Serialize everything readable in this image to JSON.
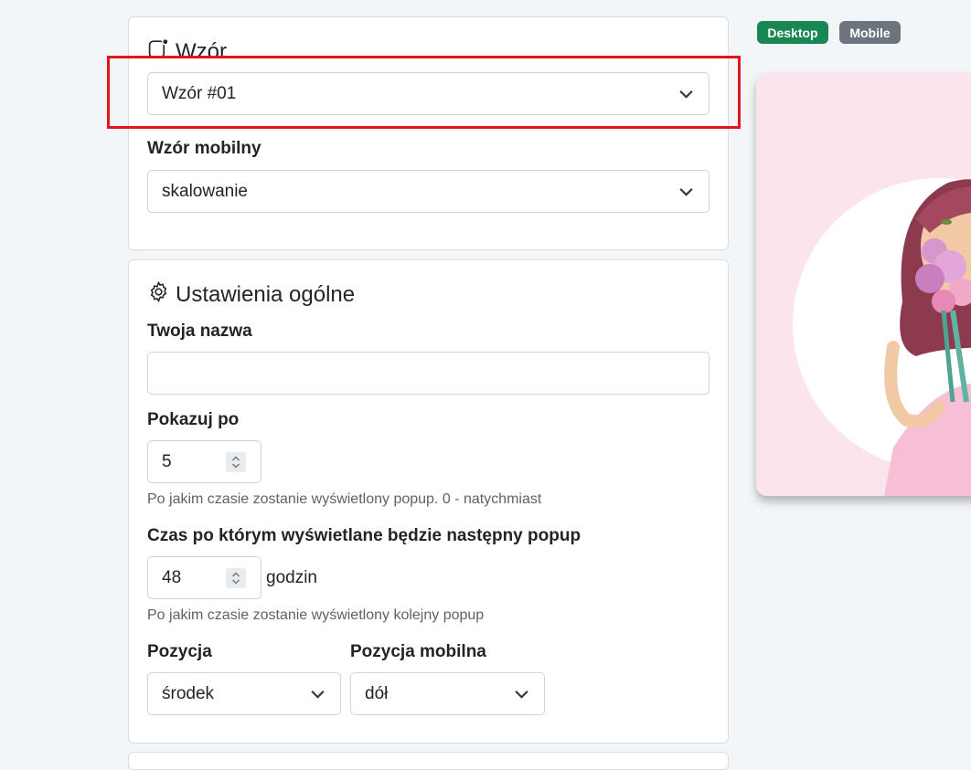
{
  "badges": {
    "desktop": "Desktop",
    "mobile": "Mobile"
  },
  "template_card": {
    "title": "Wzór",
    "template_select_value": "Wzór #01",
    "mobile_label": "Wzór mobilny",
    "mobile_select_value": "skalowanie"
  },
  "general_card": {
    "title": "Ustawienia ogólne",
    "name_label": "Twoja nazwa",
    "name_value": "",
    "show_after_label": "Pokazuj po",
    "show_after_value": "5",
    "show_after_help": "Po jakim czasie zostanie wyświetlony popup. 0 - natychmiast",
    "next_popup_label": "Czas po którym wyświetlane będzie następny popup",
    "next_popup_value": "48",
    "next_popup_unit": "godzin",
    "next_popup_help": "Po jakim czasie zostanie wyświetlony kolejny popup",
    "position_label": "Pozycja",
    "position_value": "środek",
    "mobile_position_label": "Pozycja mobilna",
    "mobile_position_value": "dół"
  },
  "colors": {
    "highlight": "#e3141b",
    "desktop_badge": "#198754",
    "mobile_badge": "#6c757d",
    "preview_bg": "#fbe4ec"
  }
}
